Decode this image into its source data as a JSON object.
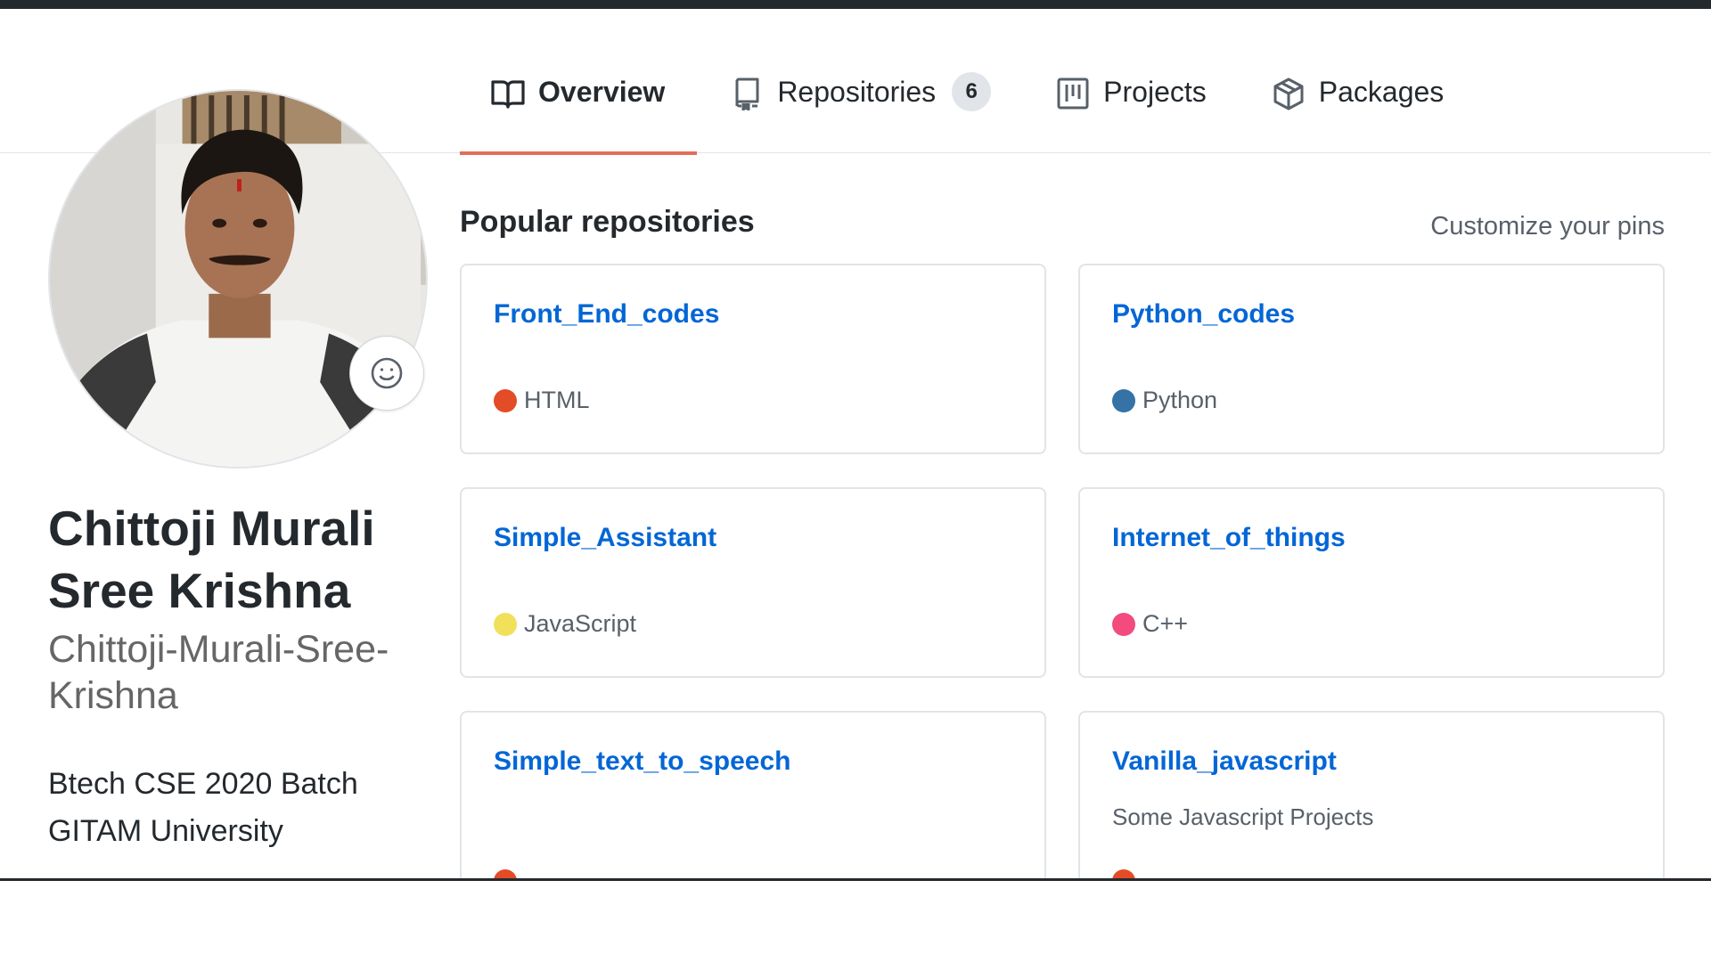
{
  "tabs": [
    {
      "label": "Overview",
      "icon": "book-icon",
      "active": true
    },
    {
      "label": "Repositories",
      "icon": "repo-icon",
      "count": "6"
    },
    {
      "label": "Projects",
      "icon": "project-board-icon"
    },
    {
      "label": "Packages",
      "icon": "package-icon"
    }
  ],
  "profile": {
    "full_name": "Chittoji Murali Sree Krishna",
    "login": "Chittoji-Murali-Sree-Krishna",
    "bio_line1": "Btech CSE 2020 Batch",
    "bio_line2": "GITAM University",
    "status_icon": "smiley-icon"
  },
  "popular": {
    "title": "Popular repositories",
    "customize_label": "Customize your pins",
    "repos": [
      {
        "name": "Front_End_codes",
        "description": "",
        "language": "HTML",
        "language_color": "#e34c26"
      },
      {
        "name": "Python_codes",
        "description": "",
        "language": "Python",
        "language_color": "#3572A5"
      },
      {
        "name": "Simple_Assistant",
        "description": "",
        "language": "JavaScript",
        "language_color": "#f1e05a"
      },
      {
        "name": "Internet_of_things",
        "description": "",
        "language": "C++",
        "language_color": "#f34b7d"
      },
      {
        "name": "Simple_text_to_speech",
        "description": "",
        "language": "",
        "language_color": "#e34c26"
      },
      {
        "name": "Vanilla_javascript",
        "description": "Some Javascript Projects",
        "language": "",
        "language_color": "#e34c26"
      }
    ]
  },
  "colors": {
    "accent_underline": "#e36d5b",
    "link_blue": "#0366d6",
    "header_dark": "#24292e"
  }
}
